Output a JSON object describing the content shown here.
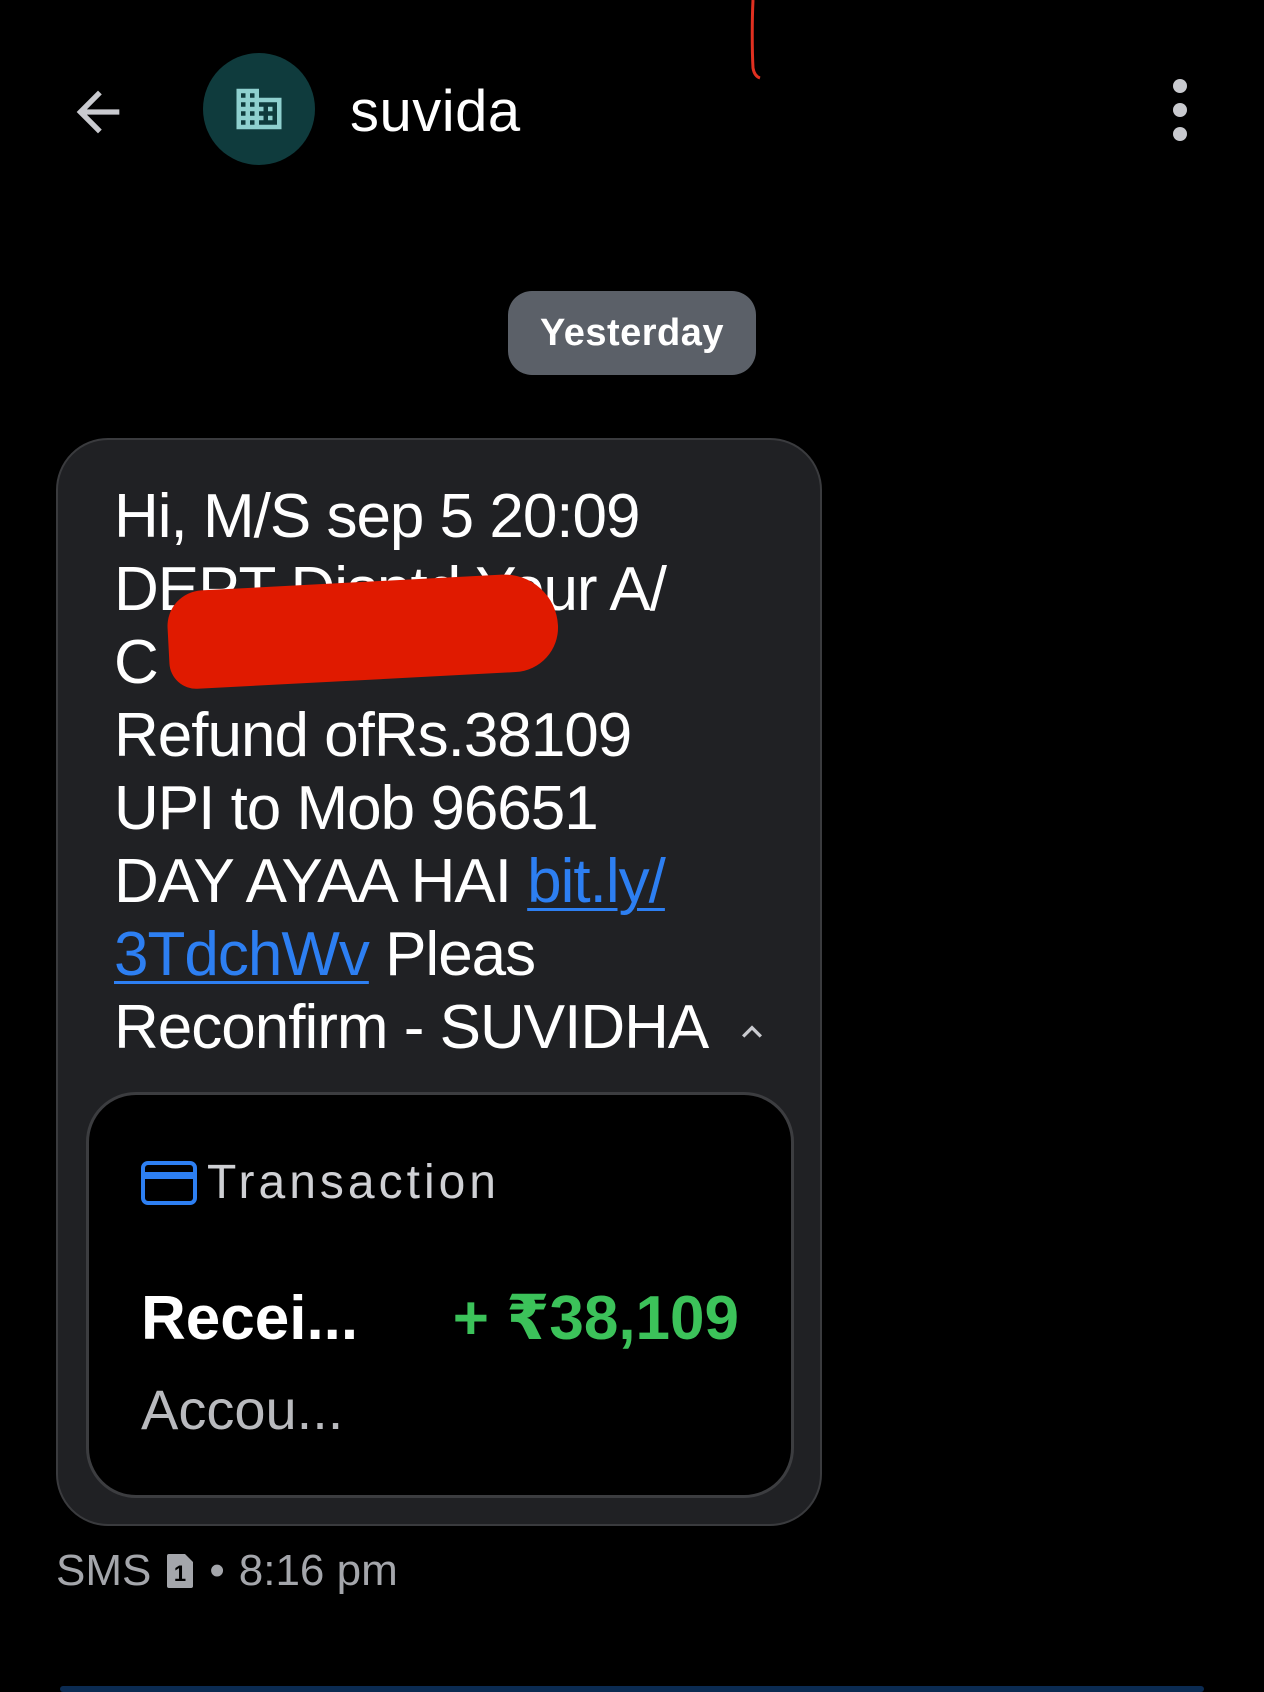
{
  "header": {
    "back_icon": "arrow-back-icon",
    "avatar_icon": "business-building-icon",
    "contact_name": "suvida",
    "menu_icon": "more-vert-icon"
  },
  "date_separator": "Yesterday",
  "message": {
    "lines": [
      "Hi, M/S sep 5 20:09",
      "DEPT Disptd Your A/",
      "C 9",
      "Refund ofRs.38109",
      "UPI to Mob 96651",
      "DAY AYAA HAI "
    ],
    "link_part1": "bit.ly/",
    "link_part2": "3TdchWv",
    "after_link": " Pleas",
    "last_line": "Reconfirm - SUVIDHA",
    "collapse_icon": "chevron-up-icon"
  },
  "transaction_card": {
    "icon": "credit-card-icon",
    "title": "Transaction",
    "label": "Recei...",
    "amount": "+ ₹38,109",
    "sub_label": "Accou..."
  },
  "meta": {
    "type": "SMS",
    "sim_icon": "sim-1-icon",
    "sim_number": "1",
    "separator": "•",
    "time": "8:16 pm"
  },
  "colors": {
    "background": "#000000",
    "bubble": "#202124",
    "link": "#2d7ff2",
    "amount_green": "#3cc25a",
    "redaction": "#e01a00",
    "avatar_bg": "#0f3b3d"
  }
}
